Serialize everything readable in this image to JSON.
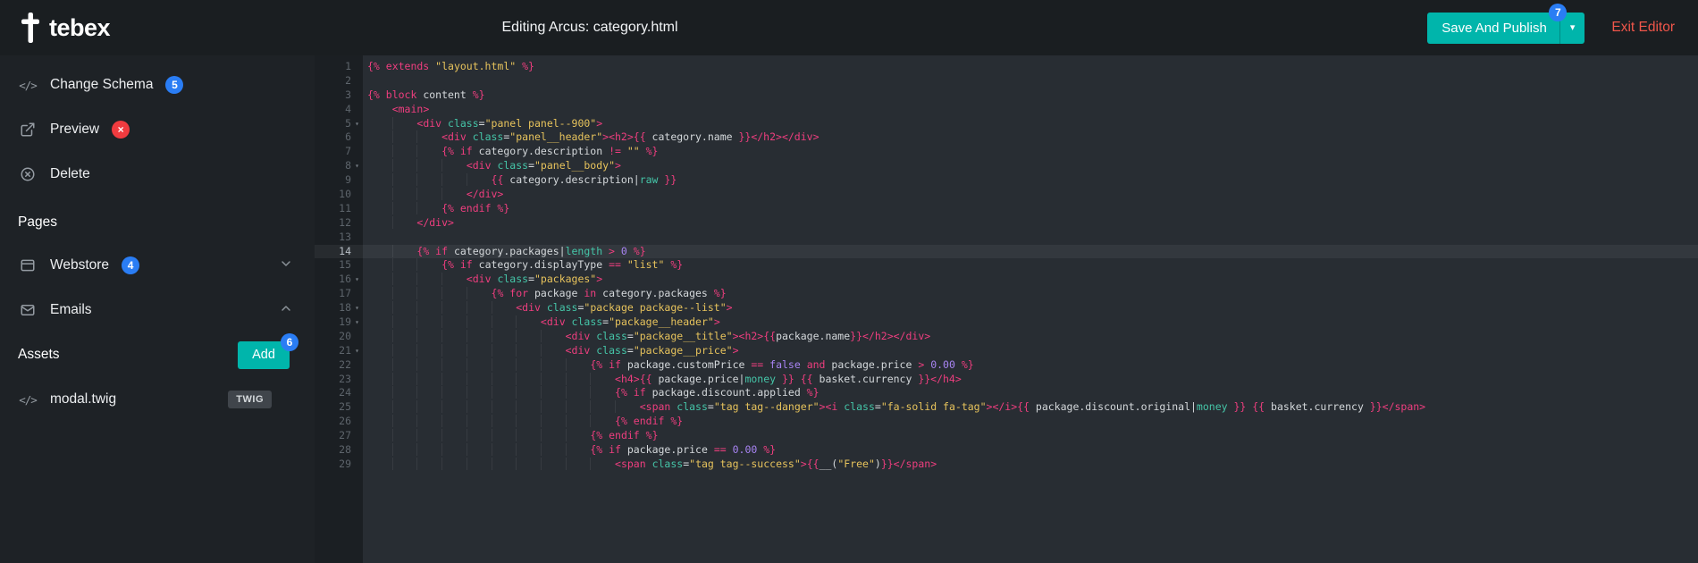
{
  "colors": {
    "teal": "#00b5ab",
    "badge_blue": "#2a7df4",
    "badge_red": "#f03b3f",
    "exit_red": "#f0564a",
    "syntax": {
      "keyword": "#ef3e7f",
      "string": "#e7c35c",
      "attr": "#45c5a8",
      "number": "#a884f3",
      "plain": "#d4d8db"
    }
  },
  "icons": {
    "code_glyph": "</>",
    "caret_down": "▾",
    "fold_caret": "▾"
  },
  "topbar": {
    "logo_text": "tebex",
    "title": "Editing Arcus: category.html",
    "save_button": {
      "label": "Save And Publish",
      "badge": "7"
    },
    "exit_label": "Exit Editor"
  },
  "sidebar": {
    "change_schema": {
      "label": "Change Schema",
      "badge": "5"
    },
    "preview": {
      "label": "Preview",
      "badge": "×"
    },
    "delete_item": {
      "label": "Delete"
    },
    "pages_header": "Pages",
    "webstore": {
      "label": "Webstore",
      "badge": "4"
    },
    "emails": {
      "label": "Emails"
    },
    "assets": {
      "label": "Assets",
      "add_label": "Add",
      "badge": "6"
    },
    "file": {
      "label": "modal.twig",
      "badge": "TWIG"
    }
  },
  "editor": {
    "active_line": 14,
    "fold_lines": [
      5,
      8,
      16,
      18,
      19,
      21
    ],
    "lines": [
      {
        "n": 1,
        "i": 0,
        "t": [
          [
            "k",
            "{% extends "
          ],
          [
            "s",
            "\"layout.html\""
          ],
          [
            "k",
            " %}"
          ]
        ]
      },
      {
        "n": 2,
        "i": 0,
        "t": []
      },
      {
        "n": 3,
        "i": 0,
        "t": [
          [
            "k",
            "{% block "
          ],
          [
            "p",
            "content"
          ],
          [
            "k",
            " %}"
          ]
        ]
      },
      {
        "n": 4,
        "i": 4,
        "t": [
          [
            "k",
            "<main>"
          ]
        ]
      },
      {
        "n": 5,
        "i": 8,
        "t": [
          [
            "k",
            "<div"
          ],
          [
            "f",
            " class"
          ],
          [
            "p",
            "="
          ],
          [
            "s",
            "\"panel panel--900\""
          ],
          [
            "k",
            ">"
          ]
        ]
      },
      {
        "n": 6,
        "i": 12,
        "t": [
          [
            "k",
            "<div"
          ],
          [
            "f",
            " class"
          ],
          [
            "p",
            "="
          ],
          [
            "s",
            "\"panel__header\""
          ],
          [
            "k",
            "><h2>{{"
          ],
          [
            "p",
            " category.name "
          ],
          [
            "k",
            "}}</h2></div>"
          ]
        ]
      },
      {
        "n": 7,
        "i": 12,
        "t": [
          [
            "k",
            "{% if "
          ],
          [
            "p",
            "category.description "
          ],
          [
            "k",
            "!= "
          ],
          [
            "s",
            "\"\""
          ],
          [
            "k",
            " %}"
          ]
        ]
      },
      {
        "n": 8,
        "i": 16,
        "t": [
          [
            "k",
            "<div"
          ],
          [
            "f",
            " class"
          ],
          [
            "p",
            "="
          ],
          [
            "s",
            "\"panel__body\""
          ],
          [
            "k",
            ">"
          ]
        ]
      },
      {
        "n": 9,
        "i": 20,
        "t": [
          [
            "k",
            "{{"
          ],
          [
            "p",
            " category.description|"
          ],
          [
            "f",
            "raw"
          ],
          [
            "k",
            " }}"
          ]
        ]
      },
      {
        "n": 10,
        "i": 16,
        "t": [
          [
            "k",
            "</div>"
          ]
        ]
      },
      {
        "n": 11,
        "i": 12,
        "t": [
          [
            "k",
            "{% endif %}"
          ]
        ]
      },
      {
        "n": 12,
        "i": 8,
        "t": [
          [
            "k",
            "</div>"
          ]
        ]
      },
      {
        "n": 13,
        "i": 0,
        "t": []
      },
      {
        "n": 14,
        "i": 8,
        "t": [
          [
            "k",
            "{% if "
          ],
          [
            "p",
            "category.packages|"
          ],
          [
            "f",
            "length"
          ],
          [
            "k",
            " > "
          ],
          [
            "n",
            "0"
          ],
          [
            "k",
            " %}"
          ]
        ]
      },
      {
        "n": 15,
        "i": 12,
        "t": [
          [
            "k",
            "{% if "
          ],
          [
            "p",
            "category.displayType "
          ],
          [
            "k",
            "== "
          ],
          [
            "s",
            "\"list\""
          ],
          [
            "k",
            " %}"
          ]
        ]
      },
      {
        "n": 16,
        "i": 16,
        "t": [
          [
            "k",
            "<div"
          ],
          [
            "f",
            " class"
          ],
          [
            "p",
            "="
          ],
          [
            "s",
            "\"packages\""
          ],
          [
            "k",
            ">"
          ]
        ]
      },
      {
        "n": 17,
        "i": 20,
        "t": [
          [
            "k",
            "{% for "
          ],
          [
            "p",
            "package"
          ],
          [
            "k",
            " in "
          ],
          [
            "p",
            "category.packages"
          ],
          [
            "k",
            " %}"
          ]
        ]
      },
      {
        "n": 18,
        "i": 24,
        "t": [
          [
            "k",
            "<div"
          ],
          [
            "f",
            " class"
          ],
          [
            "p",
            "="
          ],
          [
            "s",
            "\"package package--list\""
          ],
          [
            "k",
            ">"
          ]
        ]
      },
      {
        "n": 19,
        "i": 28,
        "t": [
          [
            "k",
            "<div"
          ],
          [
            "f",
            " class"
          ],
          [
            "p",
            "="
          ],
          [
            "s",
            "\"package__header\""
          ],
          [
            "k",
            ">"
          ]
        ]
      },
      {
        "n": 20,
        "i": 32,
        "t": [
          [
            "k",
            "<div"
          ],
          [
            "f",
            " class"
          ],
          [
            "p",
            "="
          ],
          [
            "s",
            "\"package__title\""
          ],
          [
            "k",
            "><h2>{{"
          ],
          [
            "p",
            "package.name"
          ],
          [
            "k",
            "}}</h2></div>"
          ]
        ]
      },
      {
        "n": 21,
        "i": 32,
        "t": [
          [
            "k",
            "<div"
          ],
          [
            "f",
            " class"
          ],
          [
            "p",
            "="
          ],
          [
            "s",
            "\"package__price\""
          ],
          [
            "k",
            ">"
          ]
        ]
      },
      {
        "n": 22,
        "i": 36,
        "t": [
          [
            "k",
            "{% if "
          ],
          [
            "p",
            "package.customPrice "
          ],
          [
            "k",
            "== "
          ],
          [
            "n",
            "false"
          ],
          [
            "k",
            " and "
          ],
          [
            "p",
            "package.price "
          ],
          [
            "k",
            "> "
          ],
          [
            "n",
            "0.00"
          ],
          [
            "k",
            " %}"
          ]
        ]
      },
      {
        "n": 23,
        "i": 40,
        "t": [
          [
            "k",
            "<h4>{{"
          ],
          [
            "p",
            " package.price|"
          ],
          [
            "f",
            "money"
          ],
          [
            "k",
            " }} {{"
          ],
          [
            "p",
            " basket.currency "
          ],
          [
            "k",
            "}}</h4>"
          ]
        ]
      },
      {
        "n": 24,
        "i": 40,
        "t": [
          [
            "k",
            "{% if "
          ],
          [
            "p",
            "package.discount.applied"
          ],
          [
            "k",
            " %}"
          ]
        ]
      },
      {
        "n": 25,
        "i": 44,
        "t": [
          [
            "k",
            "<span"
          ],
          [
            "f",
            " class"
          ],
          [
            "p",
            "="
          ],
          [
            "s",
            "\"tag tag--danger\""
          ],
          [
            "k",
            "><i"
          ],
          [
            "f",
            " class"
          ],
          [
            "p",
            "="
          ],
          [
            "s",
            "\"fa-solid fa-tag\""
          ],
          [
            "k",
            "></i>{{"
          ],
          [
            "p",
            " package.discount.original|"
          ],
          [
            "f",
            "money"
          ],
          [
            "k",
            " }} {{"
          ],
          [
            "p",
            " basket.currency "
          ],
          [
            "k",
            "}}</span>"
          ]
        ]
      },
      {
        "n": 26,
        "i": 40,
        "t": [
          [
            "k",
            "{% endif %}"
          ]
        ]
      },
      {
        "n": 27,
        "i": 36,
        "t": [
          [
            "k",
            "{% endif %}"
          ]
        ]
      },
      {
        "n": 28,
        "i": 36,
        "t": [
          [
            "k",
            "{% if "
          ],
          [
            "p",
            "package.price "
          ],
          [
            "k",
            "== "
          ],
          [
            "n",
            "0.00"
          ],
          [
            "k",
            " %}"
          ]
        ]
      },
      {
        "n": 29,
        "i": 40,
        "t": [
          [
            "k",
            "<span"
          ],
          [
            "f",
            " class"
          ],
          [
            "p",
            "="
          ],
          [
            "s",
            "\"tag tag--success\""
          ],
          [
            "k",
            ">{{"
          ],
          [
            "p",
            "__("
          ],
          [
            "s",
            "\"Free\""
          ],
          [
            "p",
            ")"
          ],
          [
            "k",
            "}}</span>"
          ]
        ]
      }
    ]
  }
}
